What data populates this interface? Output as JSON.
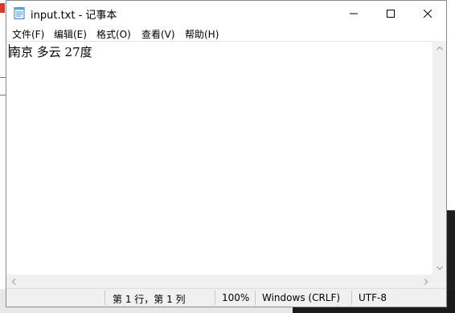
{
  "window": {
    "title": "input.txt - 记事本",
    "controls": [
      "minimize",
      "maximize",
      "close"
    ]
  },
  "menu": {
    "items": [
      {
        "label": "文件(F)"
      },
      {
        "label": "编辑(E)"
      },
      {
        "label": "格式(O)"
      },
      {
        "label": "查看(V)"
      },
      {
        "label": "帮助(H)"
      }
    ]
  },
  "editor": {
    "content": "南京 多云 27度"
  },
  "status": {
    "position": "第 1 行，第 1 列",
    "zoom": "100%",
    "line_ending": "Windows (CRLF)",
    "encoding": "UTF-8"
  },
  "icons": {
    "app": "notepad-icon",
    "minimize": "minimize-icon",
    "maximize": "maximize-icon",
    "close": "close-icon"
  }
}
